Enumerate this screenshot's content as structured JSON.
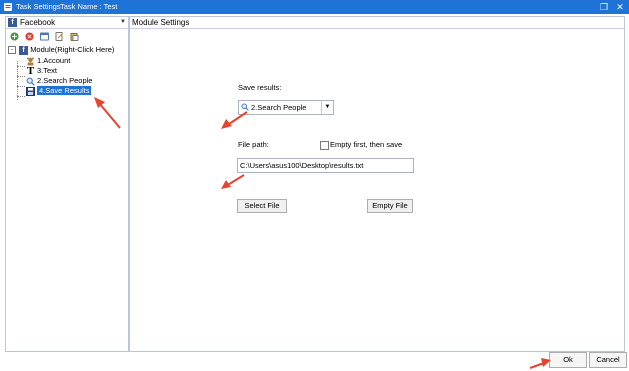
{
  "window": {
    "title": "Task Settings",
    "task_name": "Task Name : Test",
    "restore_symbol": "❐",
    "close_symbol": "✕"
  },
  "left_panel": {
    "site": "Facebook",
    "icons": [
      "add-icon",
      "delete-icon",
      "window-icon",
      "edit-icon",
      "paste-icon"
    ],
    "tree": {
      "root": "Module(Right-Click Here)",
      "expander": "-",
      "items": [
        {
          "label": "1.Account",
          "icon": "account-icon"
        },
        {
          "label": "3.Text",
          "icon": "text-icon"
        },
        {
          "label": "2.Search People",
          "icon": "search-icon"
        },
        {
          "label": "4.Save Results",
          "icon": "save-icon",
          "selected": true
        }
      ]
    }
  },
  "right_panel": {
    "header": "Module Settings",
    "save_results_label": "Save results:",
    "save_results_value": "2.Search People",
    "file_path_label": "File path:",
    "empty_first_label": "Empty first, then save",
    "empty_first_checked": false,
    "file_path_value": "C:\\Users\\asus100\\Desktop\\results.txt",
    "select_file_button": "Select File",
    "empty_file_button": "Empty File"
  },
  "footer": {
    "ok_button": "Ok",
    "cancel_button": "Cancel"
  },
  "colors": {
    "titlebar": "#1e73d6",
    "arrow": "#e8432e",
    "facebook": "#3b5998"
  }
}
